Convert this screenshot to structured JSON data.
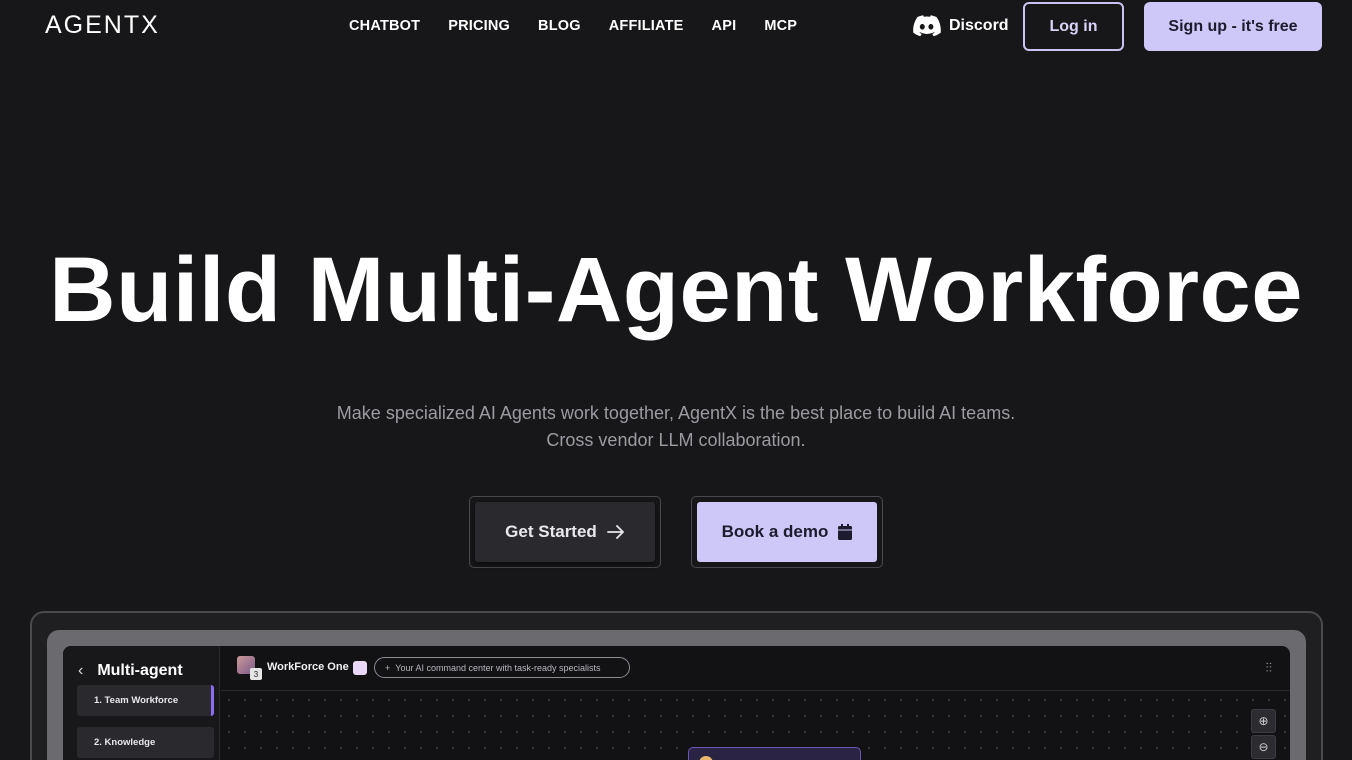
{
  "nav": {
    "logo": "AGENTX",
    "links": [
      "CHATBOT",
      "PRICING",
      "BLOG",
      "AFFILIATE",
      "API",
      "MCP"
    ],
    "discord_label": "Discord",
    "login_label": "Log in",
    "signup_label": "Sign up - it's free"
  },
  "hero": {
    "title": "Build Multi-Agent Workforce",
    "subtitle_line1": "Make specialized AI Agents work together, AgentX is the best place to build AI teams.",
    "subtitle_line2": "Cross vendor LLM collaboration.",
    "get_started_label": "Get Started",
    "book_demo_label": "Book a demo"
  },
  "preview": {
    "sidebar_title": "Multi-agent",
    "sidebar_items": [
      "1. Team Workforce",
      "2. Knowledge"
    ],
    "workforce_name": "WorkForce One",
    "workforce_count": "3",
    "workforce_description": "Your AI command center with task-ready specialists",
    "zoom_in_icon": "zoom-in-icon",
    "zoom_out_icon": "zoom-out-icon"
  },
  "colors": {
    "background": "#171618",
    "accent": "#cdc8f7",
    "muted_text": "#9c9ba1"
  }
}
